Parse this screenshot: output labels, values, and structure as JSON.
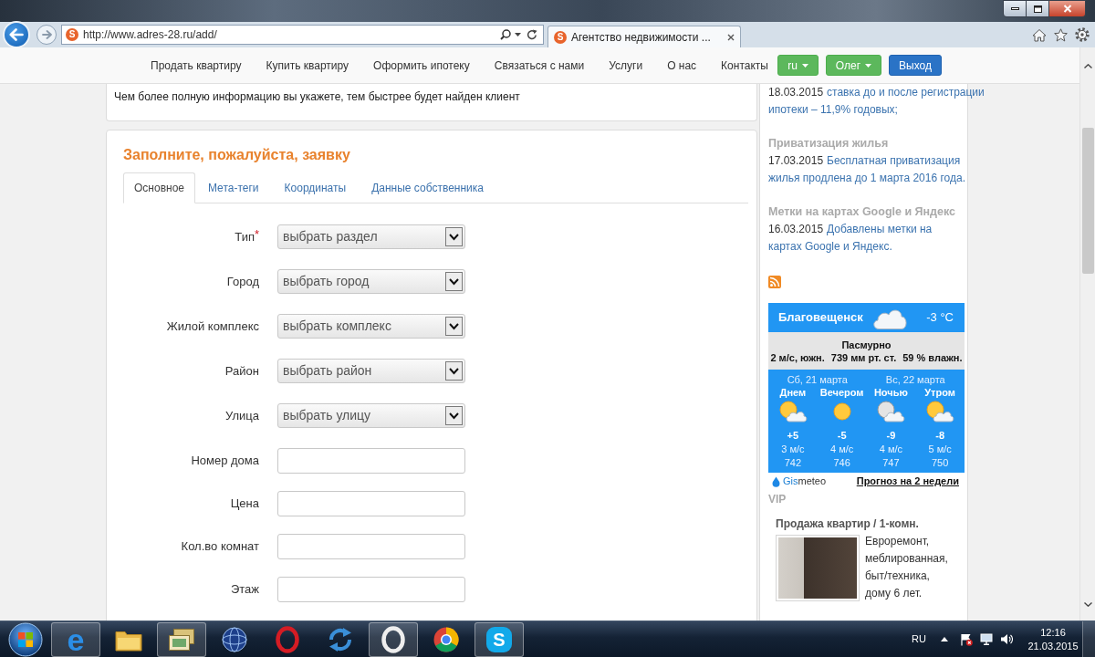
{
  "browser": {
    "address_bar": {
      "favicon": "S",
      "url": "http://www.adres-28.ru/add/"
    },
    "tabs": [
      {
        "favicon": "S",
        "title": "Агентство недвижимости ...",
        "selected": true
      }
    ]
  },
  "nav": {
    "links": [
      "Продать квартиру",
      "Купить квартиру",
      "Оформить ипотеку",
      "Связаться с нами",
      "Услуги",
      "О нас",
      "Контакты"
    ],
    "buttons": [
      {
        "label": "ru",
        "kind": "dropdown"
      },
      {
        "label": "Олег",
        "kind": "dropdown"
      },
      {
        "label": "Выход",
        "kind": "action"
      }
    ]
  },
  "intro": {
    "text": "Чем более полную информацию вы укажете, тем быстрее будет найден клиент"
  },
  "form": {
    "title": "Заполните, пожалуйста, заявку",
    "tabs": [
      {
        "label": "Основное",
        "selected": true
      },
      {
        "label": "Мета-теги",
        "selected": false
      },
      {
        "label": "Координаты",
        "selected": false
      },
      {
        "label": "Данные собственника",
        "selected": false
      }
    ],
    "fields": [
      {
        "label": "Тип",
        "required_mark": "*",
        "kind": "select",
        "value": "выбрать раздел"
      },
      {
        "label": "Город",
        "kind": "select",
        "value": "выбрать город"
      },
      {
        "label": "Жилой комплекс",
        "kind": "select",
        "value": "выбрать комплекс"
      },
      {
        "label": "Район",
        "kind": "select",
        "value": "выбрать район"
      },
      {
        "label": "Улица",
        "kind": "select",
        "value": "выбрать улицу"
      },
      {
        "label": "Номер дома",
        "kind": "text"
      },
      {
        "label": "Цена",
        "kind": "text"
      },
      {
        "label": "Кол.во комнат",
        "kind": "text"
      },
      {
        "label": "Этаж",
        "kind": "text"
      }
    ]
  },
  "sidebar": {
    "news": [
      {
        "date": "18.03.2015",
        "link_lines": [
          "ставка до и после регистрации",
          "ипотеки – 11,9% годовых;"
        ]
      },
      {
        "heading": "Приватизация жилья",
        "date": "17.03.2015",
        "link_lines": [
          "Бесплатная приватизация",
          "жилья продлена до 1 марта 2016 года."
        ]
      },
      {
        "heading": "Метки на картах Google и Яндекс",
        "date": "16.03.2015",
        "link_lines": [
          "Добавлены метки на",
          "картах Google и Яндекс."
        ]
      }
    ],
    "weather": {
      "city": "Благовещенск",
      "temperature": "-3 °C",
      "condition": "Пасмурно",
      "details": [
        "2 м/с, южн.",
        "739 мм рт. ст.",
        "59 % влажн."
      ],
      "days": [
        "Сб, 21 марта",
        "Вс, 22 марта"
      ],
      "periods": [
        {
          "label": "Днем",
          "kind": "sun_cloud",
          "temperature": "+5",
          "wind": "3 м/с",
          "pressure": "742"
        },
        {
          "label": "Вечером",
          "kind": "sun",
          "temperature": "-5",
          "wind": "4 м/с",
          "pressure": "746"
        },
        {
          "label": "Ночью",
          "kind": "moon_cloud",
          "temperature": "-9",
          "wind": "4 м/с",
          "pressure": "747"
        },
        {
          "label": "Утром",
          "kind": "sun_cloud",
          "temperature": "-8",
          "wind": "5 м/с",
          "pressure": "750"
        }
      ],
      "brand": [
        "Gis",
        "meteo"
      ],
      "forecast_link": "Прогноз на 2 недели"
    },
    "vip": {
      "heading": "VIP",
      "ads": [
        {
          "title": "Продажа квартир / 1-комн.",
          "text": "Евроремонт, меблированная, быт/техника, дому 6 лет."
        }
      ]
    }
  },
  "taskbar": {
    "apps": [
      {
        "kind": "e_logo",
        "letter": "e",
        "running": true
      },
      {
        "kind": "folder",
        "running": false
      },
      {
        "kind": "window_stack",
        "running": true
      },
      {
        "kind": "globe",
        "running": false
      },
      {
        "kind": "ring",
        "running": false
      },
      {
        "kind": "circular_arrows",
        "running": false
      },
      {
        "kind": "ring_light",
        "running": true
      },
      {
        "kind": "segmented_circle",
        "running": false
      },
      {
        "kind": "s_badge",
        "letter": "S",
        "running": true
      }
    ],
    "tray": {
      "language": "RU",
      "time": "12:16",
      "date": "21.03.2015"
    }
  }
}
